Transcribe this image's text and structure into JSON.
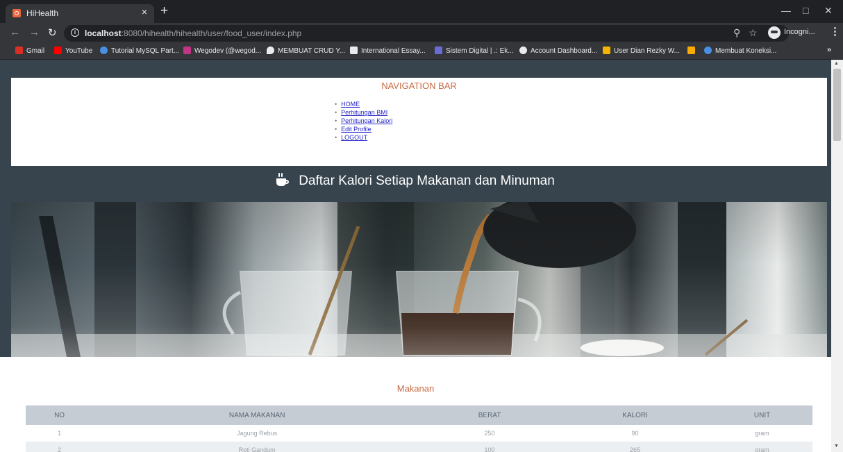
{
  "browser": {
    "tab_title": "HiHealth",
    "tab_close": "×",
    "new_tab": "+",
    "url_host": "localhost",
    "url_rest": ":8080/hihealth/hihealth/user/food_user/index.php",
    "incognito_label": "Incogni...",
    "bookmarks": [
      {
        "label": "Gmail",
        "icon": "gmail-icon",
        "color": "#d93025"
      },
      {
        "label": "YouTube",
        "icon": "youtube-icon",
        "color": "#ff0000"
      },
      {
        "label": "Tutorial MySQL Part...",
        "icon": "code-icon",
        "color": "#4a90e2"
      },
      {
        "label": "Wegodev (@wegod...",
        "icon": "instagram-icon",
        "color": "#c13584"
      },
      {
        "label": "MEMBUAT CRUD Y...",
        "icon": "pin-icon",
        "color": "#e8eaed"
      },
      {
        "label": "International Essay...",
        "icon": "doc-icon",
        "color": "#e8eaed"
      },
      {
        "label": "Sistem Digital | .: Ek...",
        "icon": "chip-icon",
        "color": "#6b6bd6"
      },
      {
        "label": "Account Dashboard...",
        "icon": "globe-icon",
        "color": "#e8eaed"
      },
      {
        "label": "User Dian Rezky W...",
        "icon": "grid-icon",
        "color": "#f4b400"
      },
      {
        "label": "",
        "icon": "image-icon",
        "color": "#f9ab00"
      },
      {
        "label": "Membuat Koneksi...",
        "icon": "code-icon",
        "color": "#4a90e2"
      }
    ],
    "bookmarks_more": "»"
  },
  "page": {
    "navbar_title": "NAVIGATION BAR",
    "nav_links": [
      "HOME",
      "Perhitungan BMI",
      "Perhitungan Kalori",
      "Edit Profile",
      "LOGOUT"
    ],
    "heading": "Daftar Kalori Setiap Makanan dan Minuman",
    "heading_icon": "coffee-cup-icon",
    "section_title": "Makanan",
    "table": {
      "headers": [
        "NO",
        "NAMA MAKANAN",
        "BERAT",
        "KALORI",
        "UNIT"
      ],
      "rows": [
        [
          "1",
          "Jagung Rebus",
          "250",
          "90",
          "gram"
        ],
        [
          "2",
          "Roti Gandum",
          "100",
          "265",
          "gram"
        ]
      ]
    }
  },
  "colors": {
    "page_background": "#37444e",
    "accent": "#c76a44",
    "table_header": "#c5ccd3"
  }
}
